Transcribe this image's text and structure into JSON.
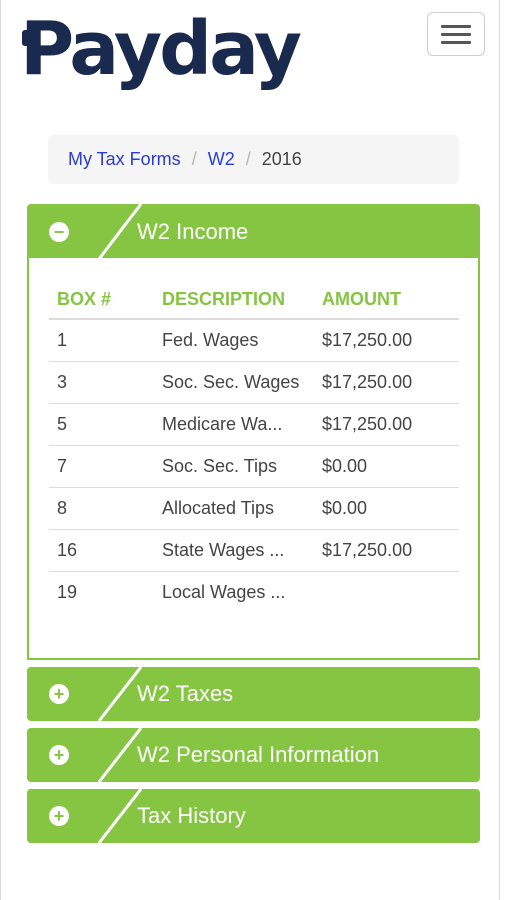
{
  "header": {
    "logo_text": "Payday",
    "menu_icon": "hamburger-menu-icon"
  },
  "breadcrumb": {
    "items": [
      {
        "label": "My Tax Forms",
        "link": true
      },
      {
        "label": "W2",
        "link": true
      },
      {
        "label": "2016",
        "link": false
      }
    ],
    "separator": "/"
  },
  "panels": [
    {
      "title": "W2 Income",
      "expanded": true,
      "icon": "minus-circle-icon"
    },
    {
      "title": "W2 Taxes",
      "expanded": false,
      "icon": "plus-circle-icon"
    },
    {
      "title": "W2 Personal Information",
      "expanded": false,
      "icon": "plus-circle-icon"
    },
    {
      "title": "Tax History",
      "expanded": false,
      "icon": "plus-circle-icon"
    }
  ],
  "w2_income": {
    "columns": [
      "BOX #",
      "DESCRIPTION",
      "AMOUNT"
    ],
    "rows": [
      {
        "box": "1",
        "description": "Fed. Wages",
        "amount": "$17,250.00"
      },
      {
        "box": "3",
        "description": "Soc. Sec. Wages",
        "amount": "$17,250.00"
      },
      {
        "box": "5",
        "description": "Medicare Wa...",
        "amount": "$17,250.00"
      },
      {
        "box": "7",
        "description": "Soc. Sec. Tips",
        "amount": "$0.00"
      },
      {
        "box": "8",
        "description": "Allocated Tips",
        "amount": "$0.00"
      },
      {
        "box": "16",
        "description": "State Wages ...",
        "amount": "$17,250.00"
      },
      {
        "box": "19",
        "description": "Local Wages ...",
        "amount": ""
      }
    ]
  },
  "colors": {
    "brand_navy": "#1a2a4f",
    "accent_green": "#86c542",
    "link_blue": "#2a3bd6"
  }
}
